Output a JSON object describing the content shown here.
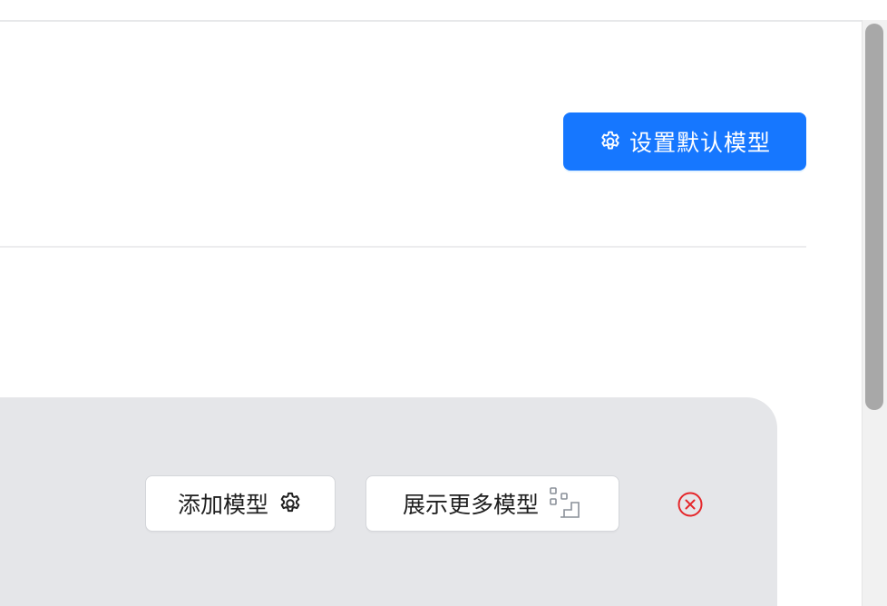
{
  "toolbar": {
    "set_default_label": "设置默认模型"
  },
  "panel": {
    "add_model_label": "添加模型",
    "show_more_label": "展示更多模型"
  },
  "icons": {
    "set_default": "gear-icon",
    "add_model": "gear-icon",
    "show_more": "stairs-dots-icon",
    "remove": "close-circle-icon"
  },
  "colors": {
    "primary": "#1677ff",
    "danger": "#e5262a",
    "panel_bg": "#e5e6e9"
  }
}
